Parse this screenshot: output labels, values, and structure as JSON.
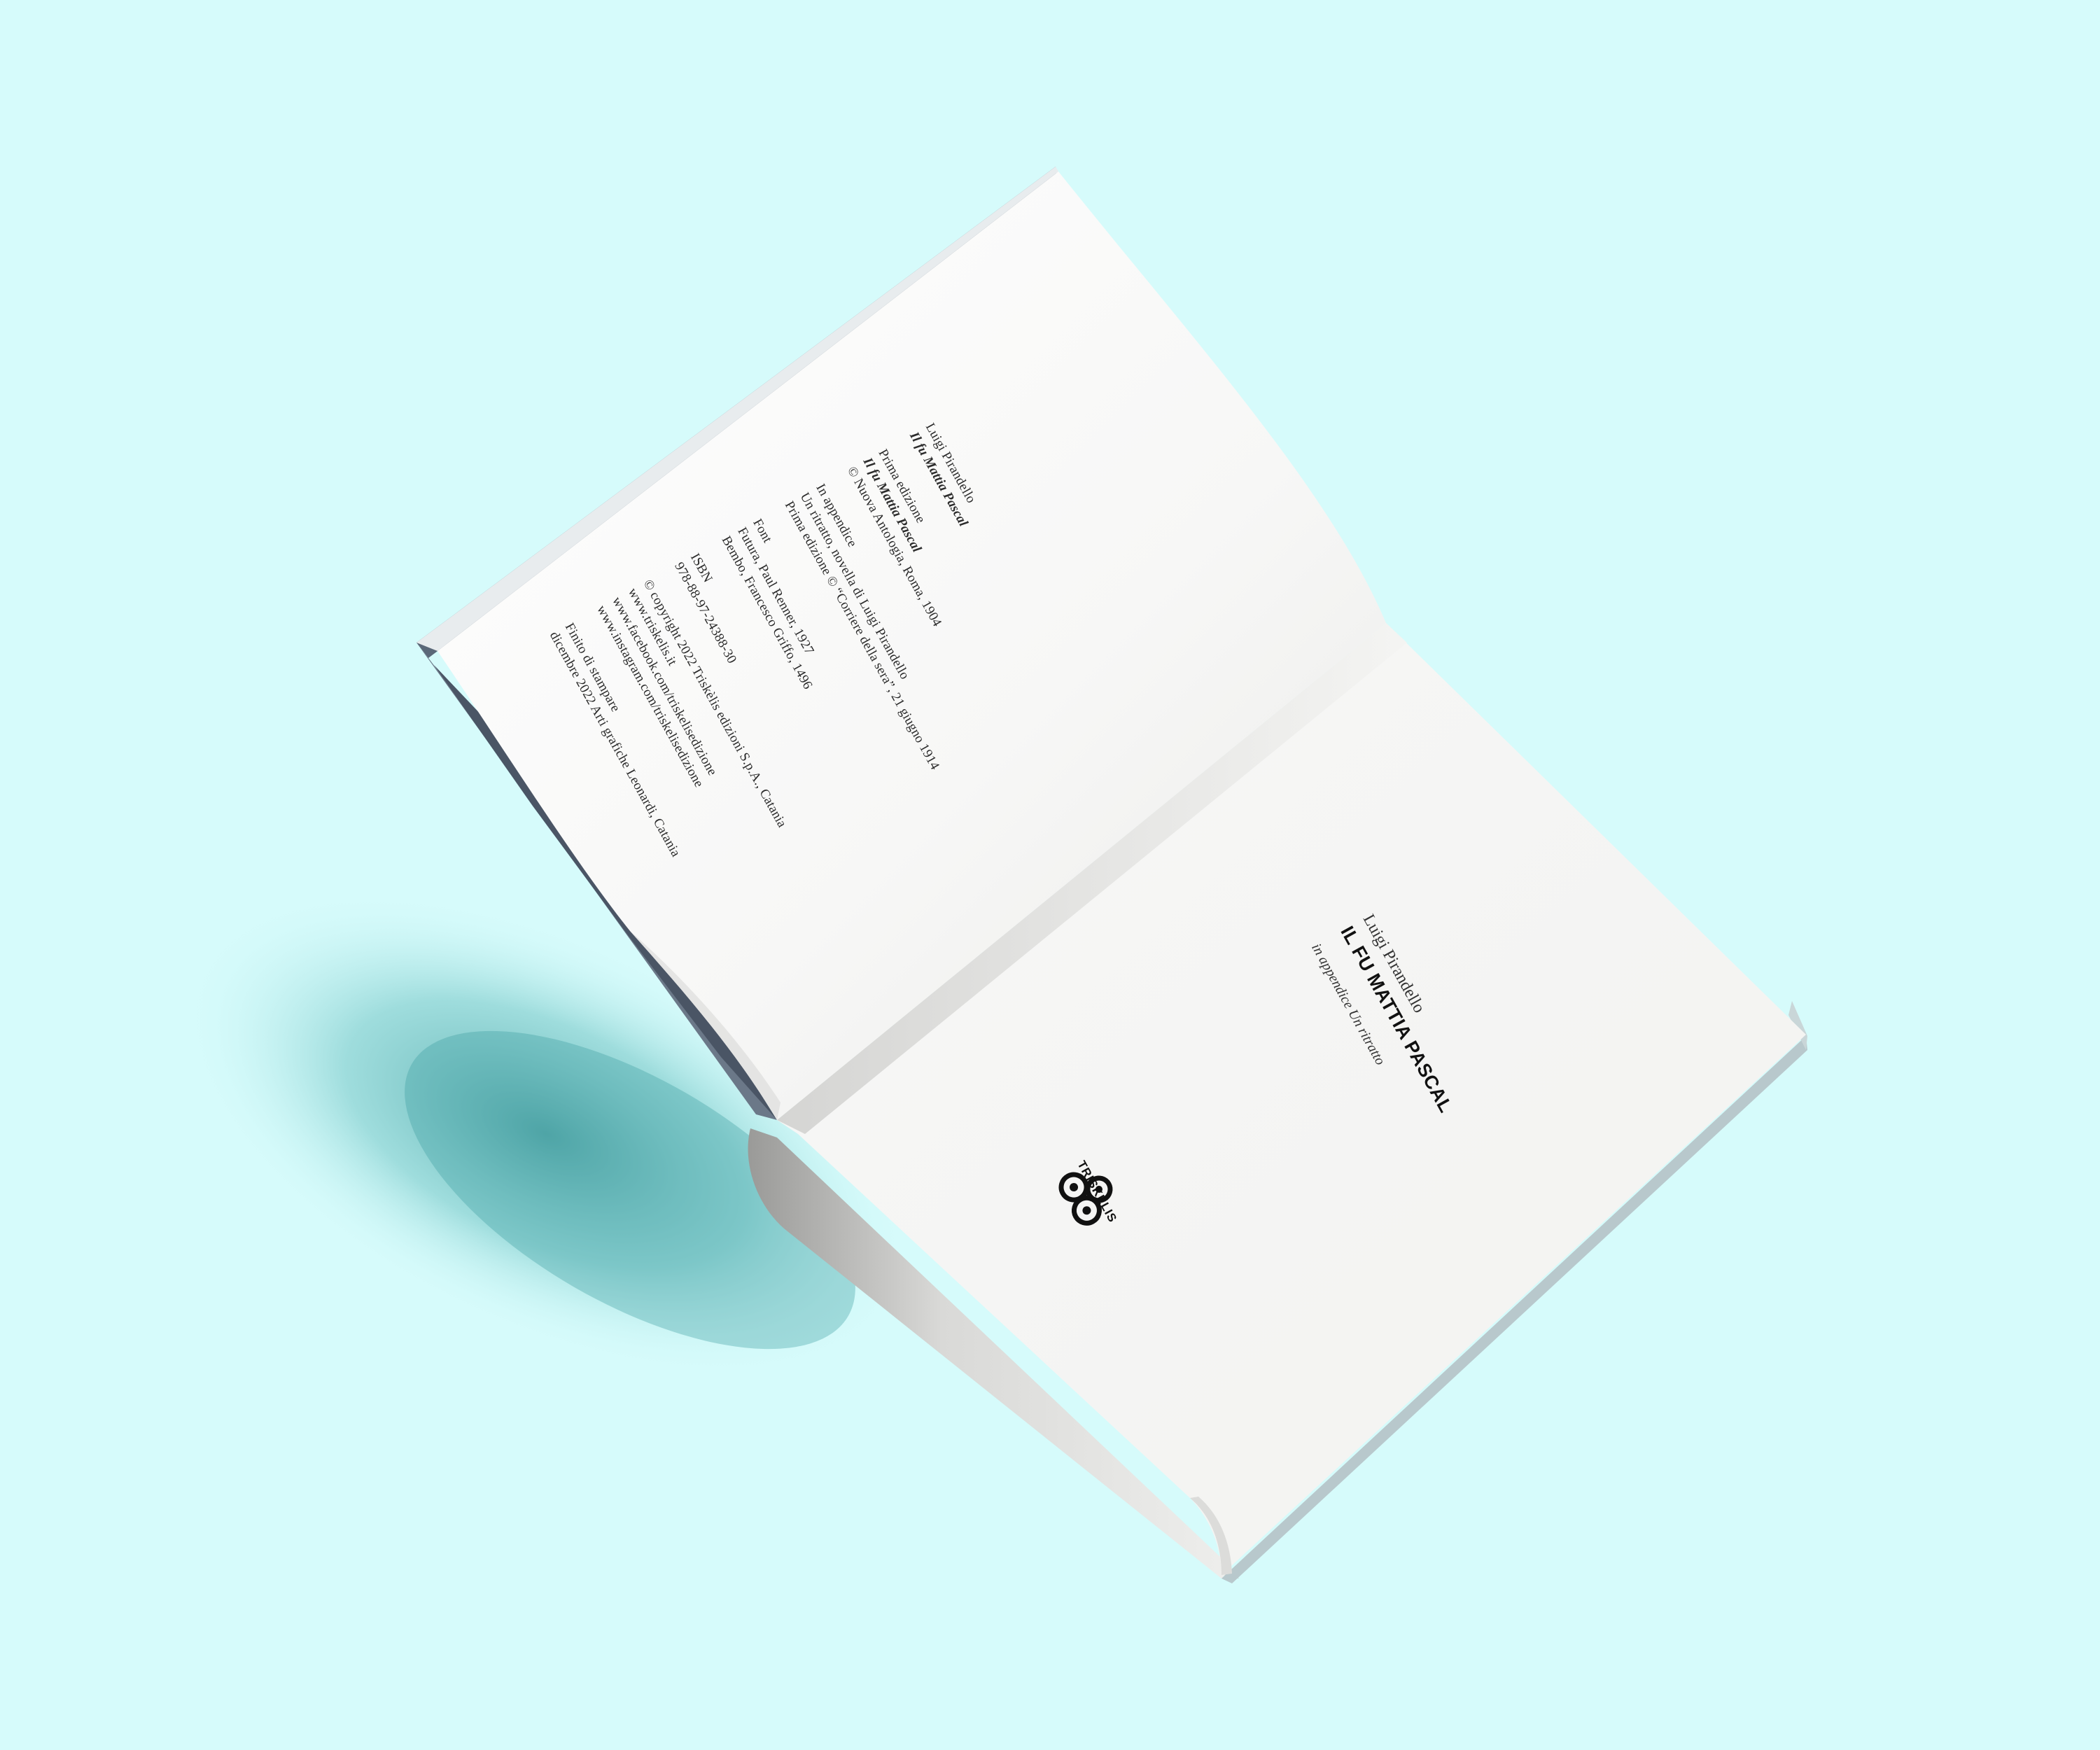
{
  "colors": {
    "background": "#d6fbfb",
    "page": "#f6f6f4",
    "cover_edge": "#5a6878",
    "ink": "#1a1a1a"
  },
  "left_page": {
    "lines": [
      {
        "text": "Luigi Pirandello",
        "style": "normal"
      },
      {
        "text": "Il fu Mattia Pascal",
        "style": "bold-italic"
      },
      {
        "text": "",
        "style": "gap"
      },
      {
        "text": "Prima edizione",
        "style": "normal"
      },
      {
        "text": "Il fu Mattia Pascal",
        "style": "bold-italic"
      },
      {
        "text": "© Nuova Antologia, Roma, 1904",
        "style": "normal"
      },
      {
        "text": "",
        "style": "gap"
      },
      {
        "text": "In appendice",
        "style": "normal"
      },
      {
        "text": "Un ritratto, novella di Luigi Pirandello",
        "style": "normal"
      },
      {
        "text": "Prima edizione © “Corriere della sera”, 21 giugno 1914",
        "style": "normal"
      },
      {
        "text": "",
        "style": "gap"
      },
      {
        "text": "Font",
        "style": "normal"
      },
      {
        "text": "Futura, Paul Renner, 1927",
        "style": "normal"
      },
      {
        "text": "Bembo, Francesco Griffo, 1496",
        "style": "normal"
      },
      {
        "text": "",
        "style": "gap"
      },
      {
        "text": "ISBN",
        "style": "normal"
      },
      {
        "text": "978-88-97-24388-30",
        "style": "normal"
      },
      {
        "text": "",
        "style": "gap"
      },
      {
        "text": "© copyright 2022 Triskèlis edizioni S.p.A., Catania",
        "style": "normal"
      },
      {
        "text": "www.triskelis.it",
        "style": "normal"
      },
      {
        "text": "www.facebook.com/triskelisedizione",
        "style": "normal"
      },
      {
        "text": "www.instagram.com/triskelisedizione",
        "style": "normal"
      },
      {
        "text": "",
        "style": "gap"
      },
      {
        "text": "Finito di stampare",
        "style": "normal"
      },
      {
        "text": "dicembre 2022 Arti grafiche Leonardi, Catania",
        "style": "normal"
      }
    ]
  },
  "right_page": {
    "author": "Luigi Pirandello",
    "title": "IL FU MATTIA PASCAL",
    "subtitle": "in appendice Un ritratto",
    "publisher_logo_text": "TRISKÈLIS"
  }
}
